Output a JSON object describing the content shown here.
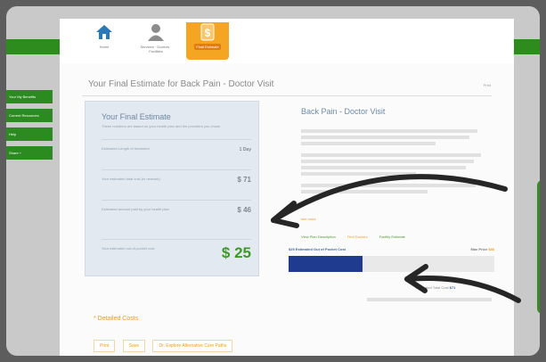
{
  "toolbar": {
    "items": [
      {
        "label": "Home"
      },
      {
        "label": "Services · Doctors · Facilities"
      },
      {
        "label": "Final Estimate"
      }
    ]
  },
  "sidebar": {
    "items": [
      {
        "label": "Your My Benefits"
      },
      {
        "label": "Current Resources"
      },
      {
        "label": "Help"
      },
      {
        "label": "Share  +"
      }
    ]
  },
  "page": {
    "title": "Your Final Estimate for Back Pain - Doctor Visit",
    "print_label": "Print"
  },
  "estimate": {
    "title": "Your Final Estimate",
    "subtitle": "These numbers are based on your health plan and the providers you chose",
    "rows": [
      {
        "label": "Estimated Length of treatment",
        "value": "1 Day"
      },
      {
        "label": "Your estimated total cost (in network)",
        "value": "$ 71"
      },
      {
        "label": "Estimated amount paid by your health plan",
        "value": "$ 46"
      },
      {
        "label": "Your estimated out-of-pocket cost",
        "value": "$ 25"
      }
    ]
  },
  "detail": {
    "title": "Back Pain - Doctor Visit",
    "see_more": "see more",
    "links": [
      "View Plan Description",
      "Find Doctors",
      "Facility Estimate"
    ]
  },
  "cost_bar": {
    "left_label": "$25 Estimated Out of Pocket Cost",
    "max_prefix": "Max Price",
    "max_value": "$46",
    "fraction": 0.36,
    "line1_label": "Estimated Total Cost",
    "line1_value": "$71"
  },
  "detailed_costs": {
    "label": "* Detailed Costs"
  },
  "buttons": [
    "Print",
    "Save",
    "Dr. Explore Alternative Care Paths"
  ],
  "colors": {
    "green": "#2e8b1e",
    "orange": "#f39a1d",
    "navy": "#1f3b8f"
  }
}
